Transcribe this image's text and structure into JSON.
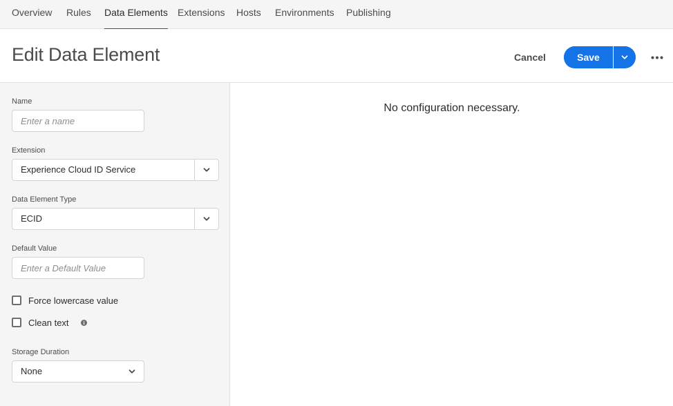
{
  "nav": {
    "tabs": [
      {
        "label": "Overview"
      },
      {
        "label": "Rules"
      },
      {
        "label": "Data Elements"
      },
      {
        "label": "Extensions"
      },
      {
        "label": "Hosts"
      },
      {
        "label": "Environments"
      },
      {
        "label": "Publishing"
      }
    ],
    "active": "Data Elements"
  },
  "header": {
    "title": "Edit Data Element",
    "cancel_label": "Cancel",
    "save_label": "Save",
    "save_dropdown_icon": "chevron-down-icon",
    "more_icon": "ellipsis-icon"
  },
  "form": {
    "name": {
      "label": "Name",
      "value": "",
      "placeholder": "Enter a name"
    },
    "extension": {
      "label": "Extension",
      "value": "Experience Cloud ID Service"
    },
    "type": {
      "label": "Data Element Type",
      "value": "ECID"
    },
    "default_value": {
      "label": "Default Value",
      "value": "",
      "placeholder": "Enter a Default Value"
    },
    "force_lowercase": {
      "label": "Force lowercase value",
      "checked": false
    },
    "clean_text": {
      "label": "Clean text",
      "checked": false,
      "info_icon": "info-icon"
    },
    "storage_duration": {
      "label": "Storage Duration",
      "value": "None"
    }
  },
  "config_panel": {
    "message": "No configuration necessary."
  },
  "colors": {
    "accent": "#1473e6",
    "panel_bg": "#f5f5f5",
    "border": "#e1e1e1"
  }
}
